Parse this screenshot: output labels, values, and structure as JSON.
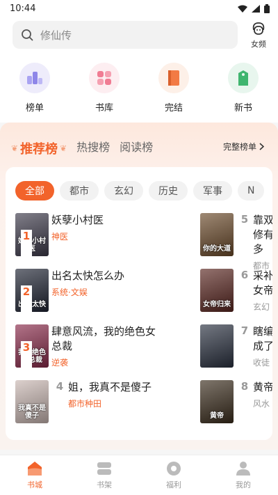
{
  "status": {
    "time": "10:44"
  },
  "search": {
    "placeholder": "修仙传",
    "gender_label": "女频"
  },
  "quick_entries": [
    {
      "label": "榜单",
      "icon": "ranking-icon",
      "bg": "#eeecfb",
      "color": "#8e86e8"
    },
    {
      "label": "书库",
      "icon": "library-icon",
      "bg": "#fdeef1",
      "color": "#f07c93"
    },
    {
      "label": "完结",
      "icon": "book-complete-icon",
      "bg": "#fdf0e8",
      "color": "#f27a45"
    },
    {
      "label": "新书",
      "icon": "new-book-icon",
      "bg": "#e8f6ee",
      "color": "#3fb56f"
    }
  ],
  "ranking": {
    "tabs": [
      "推荐榜",
      "热搜榜",
      "阅读榜"
    ],
    "full_list_label": "完整榜单",
    "chips": [
      "全部",
      "都市",
      "玄幻",
      "历史",
      "军事",
      "N"
    ],
    "books": [
      {
        "rank": "1",
        "title": "妖孽小村医",
        "tag": "神医",
        "cover_text": "妖孽小村医",
        "cover_color": "#3d3a4a"
      },
      {
        "rank": "2",
        "title": "出名太快怎么办",
        "tag": "系统·文娱",
        "cover_text": "出名太快",
        "cover_color": "#1f2433"
      },
      {
        "rank": "3",
        "title": "肆意风流，我的绝色女总裁",
        "tag": "逆袭",
        "cover_text": "我的绝色女总裁",
        "cover_color": "#8a2a4a"
      },
      {
        "rank": "4",
        "title": "姐，我真不是傻子",
        "tag": "都市种田",
        "cover_text": "我真不是傻子",
        "cover_color": "#c9b7b2"
      },
      {
        "rank": "5",
        "title": "靠双修有多",
        "tag": "都市",
        "cover_text": "你的大道",
        "cover_color": "#6b4a2a"
      },
      {
        "rank": "6",
        "title": "采补女帝",
        "tag": "玄幻",
        "cover_text": "女帝归来",
        "cover_color": "#5a2620"
      },
      {
        "rank": "7",
        "title": "瞎编成了",
        "tag": "收徒",
        "cover_text": "",
        "cover_color": "#2a3140"
      },
      {
        "rank": "8",
        "title": "黄帝",
        "tag": "风水",
        "cover_text": "黄帝",
        "cover_color": "#3a2c1c"
      }
    ]
  },
  "bottom_nav": [
    {
      "label": "书城",
      "icon": "bookstore-icon",
      "active": true
    },
    {
      "label": "书架",
      "icon": "bookshelf-icon",
      "active": false
    },
    {
      "label": "福利",
      "icon": "welfare-icon",
      "active": false
    },
    {
      "label": "我的",
      "icon": "profile-icon",
      "active": false
    }
  ]
}
